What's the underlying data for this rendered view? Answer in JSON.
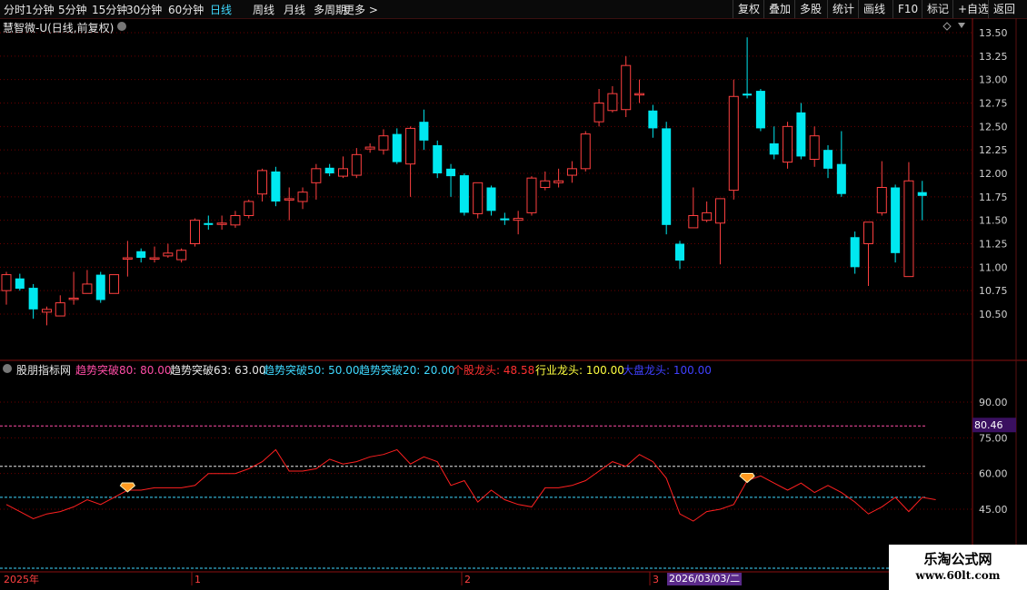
{
  "toolbar": {
    "periods": [
      "分时",
      "1分钟",
      "5分钟",
      "15分钟",
      "30分钟",
      "60分钟",
      "日线",
      "周线",
      "月线",
      "多周期",
      "更多 >"
    ],
    "active_period": "日线",
    "right_buttons": [
      "复权",
      "叠加",
      "多股",
      "统计",
      "画线",
      "F10",
      "标记",
      "+自选",
      "返回"
    ]
  },
  "chart_title": "慧智微-U(日线,前复权)",
  "price_axis": {
    "ticks": [
      "13.50",
      "13.25",
      "13.00",
      "12.75",
      "12.50",
      "12.25",
      "12.00",
      "11.75",
      "11.50",
      "11.25",
      "11.00",
      "10.75",
      "10.50"
    ]
  },
  "indicator": {
    "name": "股朋指标网",
    "legend": [
      {
        "text": "趋势突破80: 80.00",
        "color": "#ff4da6"
      },
      {
        "text": "趋势突破63: 63.00",
        "color": "#e8e8e8"
      },
      {
        "text": "趋势突破50: 50.00",
        "color": "#3fd9ff"
      },
      {
        "text": "趋势突破20: 20.00",
        "color": "#3fd9ff"
      },
      {
        "text": "个股龙头: 48.58",
        "color": "#ff3030"
      },
      {
        "text": "行业龙头: 100.00",
        "color": "#ffff40"
      },
      {
        "text": "大盘龙头: 100.00",
        "color": "#4040ff"
      }
    ],
    "axis_ticks": [
      "90.00",
      "75.00",
      "60.00",
      "45.00"
    ],
    "current_value": "80.46"
  },
  "time_axis": {
    "labels": [
      "2025年",
      "1",
      "2",
      "3"
    ],
    "cursor_date": "2026/03/03/二"
  },
  "watermark": {
    "line1": "乐淘公式网",
    "line2": "www.60lt.com"
  },
  "colors": {
    "up": "#ff4040",
    "down": "#00e8f0",
    "grid": "#6a0000",
    "line80": "#ff4da6",
    "line63": "#e8e8e8",
    "line50": "#3fd9ff",
    "indicator": "#ff2020"
  },
  "chart_data": {
    "type": "candlestick",
    "title": "慧智微-U(日线,前复权)",
    "ylim": [
      10.25,
      13.55
    ],
    "candles": [
      {
        "o": 10.75,
        "h": 10.95,
        "l": 10.6,
        "c": 10.92
      },
      {
        "o": 10.88,
        "h": 10.93,
        "l": 10.75,
        "c": 10.77
      },
      {
        "o": 10.78,
        "h": 10.82,
        "l": 10.45,
        "c": 10.55
      },
      {
        "o": 10.52,
        "h": 10.58,
        "l": 10.38,
        "c": 10.55
      },
      {
        "o": 10.48,
        "h": 10.7,
        "l": 10.48,
        "c": 10.62
      },
      {
        "o": 10.66,
        "h": 10.95,
        "l": 10.6,
        "c": 10.67
      },
      {
        "o": 10.72,
        "h": 10.97,
        "l": 10.72,
        "c": 10.82
      },
      {
        "o": 10.92,
        "h": 10.95,
        "l": 10.62,
        "c": 10.65
      },
      {
        "o": 10.72,
        "h": 10.92,
        "l": 10.72,
        "c": 10.92
      },
      {
        "o": 11.1,
        "h": 11.28,
        "l": 10.9,
        "c": 11.1
      },
      {
        "o": 11.17,
        "h": 11.2,
        "l": 11.05,
        "c": 11.1
      },
      {
        "o": 11.09,
        "h": 11.22,
        "l": 11.05,
        "c": 11.1
      },
      {
        "o": 11.12,
        "h": 11.25,
        "l": 11.1,
        "c": 11.15
      },
      {
        "o": 11.08,
        "h": 11.2,
        "l": 11.05,
        "c": 11.18
      },
      {
        "o": 11.25,
        "h": 11.52,
        "l": 11.22,
        "c": 11.5
      },
      {
        "o": 11.47,
        "h": 11.55,
        "l": 11.4,
        "c": 11.45
      },
      {
        "o": 11.47,
        "h": 11.55,
        "l": 11.4,
        "c": 11.47
      },
      {
        "o": 11.45,
        "h": 11.6,
        "l": 11.42,
        "c": 11.55
      },
      {
        "o": 11.55,
        "h": 11.72,
        "l": 11.52,
        "c": 11.7
      },
      {
        "o": 11.78,
        "h": 12.05,
        "l": 11.7,
        "c": 12.03
      },
      {
        "o": 12.02,
        "h": 12.07,
        "l": 11.65,
        "c": 11.7
      },
      {
        "o": 11.72,
        "h": 11.85,
        "l": 11.5,
        "c": 11.73
      },
      {
        "o": 11.7,
        "h": 11.85,
        "l": 11.62,
        "c": 11.8
      },
      {
        "o": 11.9,
        "h": 12.1,
        "l": 11.72,
        "c": 12.05
      },
      {
        "o": 12.06,
        "h": 12.1,
        "l": 11.97,
        "c": 12.0
      },
      {
        "o": 11.97,
        "h": 12.18,
        "l": 11.95,
        "c": 12.05
      },
      {
        "o": 11.98,
        "h": 12.27,
        "l": 11.95,
        "c": 12.2
      },
      {
        "o": 12.26,
        "h": 12.32,
        "l": 12.22,
        "c": 12.28
      },
      {
        "o": 12.25,
        "h": 12.47,
        "l": 12.2,
        "c": 12.4
      },
      {
        "o": 12.42,
        "h": 12.48,
        "l": 12.1,
        "c": 12.12
      },
      {
        "o": 12.1,
        "h": 12.5,
        "l": 11.75,
        "c": 12.48
      },
      {
        "o": 12.55,
        "h": 12.68,
        "l": 12.25,
        "c": 12.35
      },
      {
        "o": 12.3,
        "h": 12.35,
        "l": 11.95,
        "c": 12.0
      },
      {
        "o": 12.05,
        "h": 12.1,
        "l": 11.75,
        "c": 11.97
      },
      {
        "o": 11.98,
        "h": 12.0,
        "l": 11.55,
        "c": 11.58
      },
      {
        "o": 11.57,
        "h": 11.9,
        "l": 11.52,
        "c": 11.9
      },
      {
        "o": 11.85,
        "h": 11.87,
        "l": 11.55,
        "c": 11.6
      },
      {
        "o": 11.52,
        "h": 11.58,
        "l": 11.45,
        "c": 11.5
      },
      {
        "o": 11.5,
        "h": 11.6,
        "l": 11.35,
        "c": 11.52
      },
      {
        "o": 11.58,
        "h": 11.97,
        "l": 11.55,
        "c": 11.95
      },
      {
        "o": 11.85,
        "h": 12.02,
        "l": 11.82,
        "c": 11.92
      },
      {
        "o": 11.9,
        "h": 12.05,
        "l": 11.85,
        "c": 11.92
      },
      {
        "o": 11.98,
        "h": 12.13,
        "l": 11.9,
        "c": 12.05
      },
      {
        "o": 12.05,
        "h": 12.45,
        "l": 12.02,
        "c": 12.42
      },
      {
        "o": 12.55,
        "h": 12.9,
        "l": 12.5,
        "c": 12.75
      },
      {
        "o": 12.67,
        "h": 12.93,
        "l": 12.65,
        "c": 12.85
      },
      {
        "o": 12.68,
        "h": 13.25,
        "l": 12.6,
        "c": 13.15
      },
      {
        "o": 12.85,
        "h": 13.0,
        "l": 12.75,
        "c": 12.85
      },
      {
        "o": 12.67,
        "h": 12.73,
        "l": 12.38,
        "c": 12.48
      },
      {
        "o": 12.48,
        "h": 12.55,
        "l": 11.35,
        "c": 11.45
      },
      {
        "o": 11.25,
        "h": 11.28,
        "l": 10.98,
        "c": 11.07
      },
      {
        "o": 11.42,
        "h": 11.85,
        "l": 11.42,
        "c": 11.55
      },
      {
        "o": 11.5,
        "h": 11.7,
        "l": 11.48,
        "c": 11.58
      },
      {
        "o": 11.47,
        "h": 11.73,
        "l": 11.03,
        "c": 11.73
      },
      {
        "o": 11.82,
        "h": 13.0,
        "l": 11.72,
        "c": 12.82
      },
      {
        "o": 12.85,
        "h": 13.45,
        "l": 12.8,
        "c": 12.83
      },
      {
        "o": 12.88,
        "h": 12.9,
        "l": 12.45,
        "c": 12.48
      },
      {
        "o": 12.32,
        "h": 12.5,
        "l": 12.15,
        "c": 12.2
      },
      {
        "o": 12.12,
        "h": 12.55,
        "l": 12.05,
        "c": 12.5
      },
      {
        "o": 12.65,
        "h": 12.75,
        "l": 12.15,
        "c": 12.18
      },
      {
        "o": 12.15,
        "h": 12.5,
        "l": 12.07,
        "c": 12.4
      },
      {
        "o": 12.25,
        "h": 12.3,
        "l": 11.95,
        "c": 12.05
      },
      {
        "o": 12.1,
        "h": 12.45,
        "l": 11.75,
        "c": 11.78
      },
      {
        "o": 11.32,
        "h": 11.38,
        "l": 10.93,
        "c": 11.0
      },
      {
        "o": 11.25,
        "h": 11.45,
        "l": 10.8,
        "c": 11.48
      },
      {
        "o": 11.58,
        "h": 12.13,
        "l": 11.55,
        "c": 11.85
      },
      {
        "o": 11.85,
        "h": 11.88,
        "l": 11.05,
        "c": 11.15
      },
      {
        "o": 10.9,
        "h": 12.12,
        "l": 10.9,
        "c": 11.92
      },
      {
        "o": 11.8,
        "h": 11.92,
        "l": 11.5,
        "c": 11.76
      }
    ],
    "indicator_series": {
      "name": "个股龙头",
      "ylim": [
        40,
        95
      ],
      "values": [
        47,
        44,
        41,
        43,
        44,
        46,
        49,
        47,
        50,
        53,
        53,
        54,
        54,
        54,
        55,
        60,
        60,
        60,
        62,
        65,
        70,
        61,
        61,
        62,
        66,
        64,
        65,
        67,
        68,
        70,
        64,
        67,
        65,
        55,
        57,
        48,
        53,
        49,
        47,
        46,
        54,
        54,
        55,
        57,
        61,
        65,
        63,
        68,
        65,
        58,
        43,
        40,
        44,
        45,
        47,
        57,
        59,
        56,
        53,
        56,
        52,
        55,
        52,
        48,
        43,
        46,
        50,
        44,
        50,
        49
      ],
      "markers": [
        9,
        55
      ]
    },
    "reference_lines": [
      80,
      63,
      50,
      20
    ]
  }
}
